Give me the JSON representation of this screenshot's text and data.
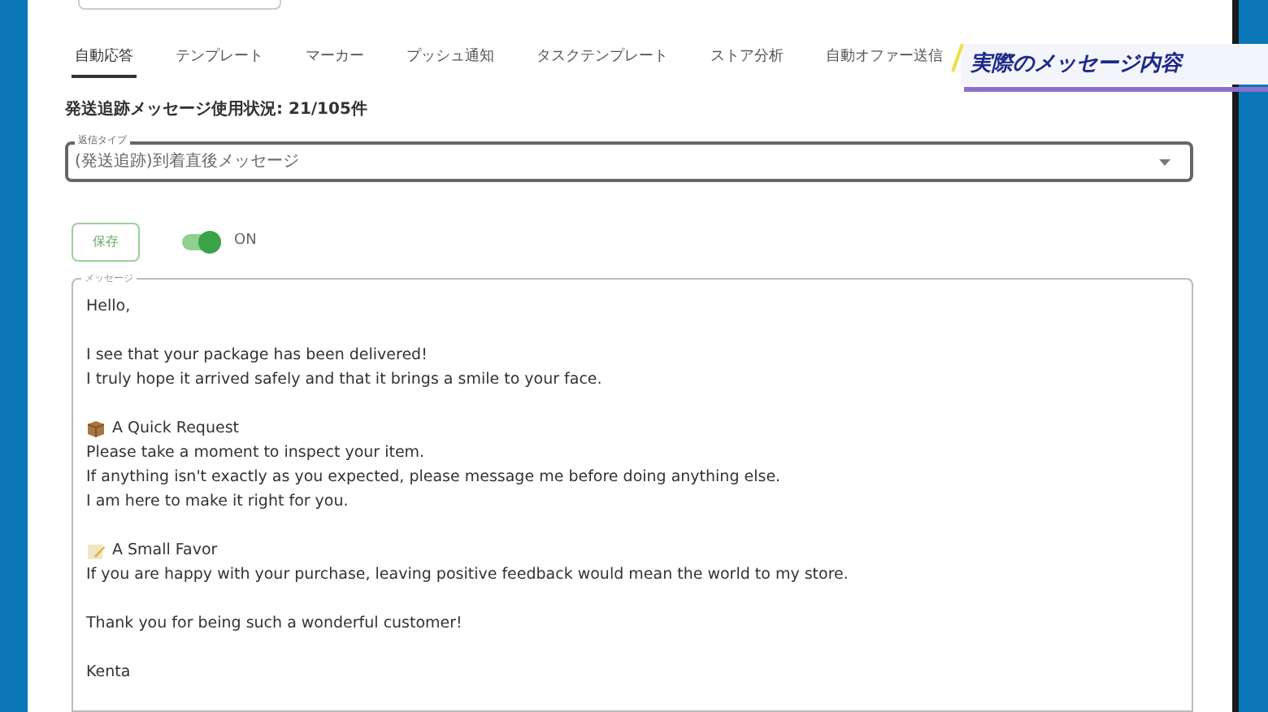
{
  "tabs": [
    {
      "label": "自動応答",
      "selected": true
    },
    {
      "label": "テンプレート",
      "selected": false
    },
    {
      "label": "マーカー",
      "selected": false
    },
    {
      "label": "プッシュ通知",
      "selected": false
    },
    {
      "label": "タスクテンプレート",
      "selected": false
    },
    {
      "label": "ストア分析",
      "selected": false
    },
    {
      "label": "自動オファー送信",
      "selected": false
    }
  ],
  "caption": "実際のメッセージ内容",
  "usage": "発送追跡メッセージ使用状況: 21/105件",
  "reply_type": {
    "label": "返信タイプ",
    "value": "(発送追跡)到着直後メッセージ"
  },
  "save_button": "保存",
  "toggle": {
    "on": true,
    "label": "ON"
  },
  "message": {
    "label": "メッセージ",
    "paragraphs": [
      [
        {
          "kind": "text",
          "text": "Hello,"
        }
      ],
      [
        {
          "kind": "text",
          "text": "I see that your package has been delivered!"
        },
        {
          "kind": "text",
          "text": "I truly hope it arrived safely and that it brings a smile to your face."
        }
      ],
      [
        {
          "kind": "package",
          "text": "A Quick Request"
        },
        {
          "kind": "text",
          "text": "Please take a moment to inspect your item."
        },
        {
          "kind": "text",
          "text": "If anything isn't exactly as you expected, please message me before doing anything else."
        },
        {
          "kind": "text",
          "text": "I am here to make it right for you."
        }
      ],
      [
        {
          "kind": "memo",
          "text": "A Small Favor"
        },
        {
          "kind": "text",
          "text": "If you are happy with your purchase, leaving positive feedback would mean the world to my store."
        }
      ],
      [
        {
          "kind": "text",
          "text": "Thank you for being such a wonderful customer!"
        }
      ],
      [
        {
          "kind": "text",
          "text": "Kenta"
        }
      ]
    ]
  }
}
